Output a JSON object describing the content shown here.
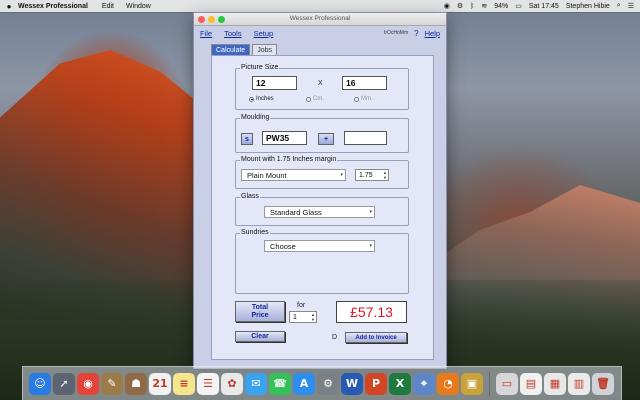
{
  "menubar": {
    "app_name": "Wessex Professional",
    "menus": [
      "Edit",
      "Window"
    ],
    "battery": "94%",
    "clock": "Sat 17:45",
    "user": "Stephen Hibie"
  },
  "window": {
    "title": "Wessex Professional",
    "menu": {
      "file": "File",
      "tools": "Tools",
      "setup": "Setup",
      "help": "Help"
    },
    "lang_label": "IrOcHoMm",
    "tabs": [
      {
        "label": "Calculate",
        "active": true
      },
      {
        "label": "Jobs",
        "active": false
      }
    ]
  },
  "picture_size": {
    "title": "Picture Size",
    "width": "12",
    "height": "16",
    "separator": "X",
    "units": [
      {
        "label": "Inches",
        "selected": true
      },
      {
        "label": "Cm.",
        "selected": false
      },
      {
        "label": "Mm.",
        "selected": false
      }
    ]
  },
  "moulding": {
    "title": "Moulding",
    "search_label": "s",
    "code": "PW35",
    "add_label": "+",
    "second_code": ""
  },
  "mount": {
    "title": "Mount with 1.75 Inches margin",
    "type": "Plain Mount",
    "margin": "1.75"
  },
  "glass": {
    "title": "Glass",
    "type": "Standard Glass"
  },
  "sundries": {
    "title": "Sundries",
    "choice": "Choose"
  },
  "pricing": {
    "total_label_line1": "Total",
    "total_label_line2": "Price",
    "for_label": "for",
    "quantity": "1",
    "price": "£57.13",
    "clear_label": "Clear",
    "invoice_marker": "D",
    "add_invoice_label": "Add to Invoice"
  },
  "dock": {
    "items": [
      {
        "name": "finder",
        "glyph": "☺",
        "color": "#2a7be4"
      },
      {
        "name": "launchpad",
        "glyph": "➚",
        "color": "#5b6470"
      },
      {
        "name": "chrome",
        "glyph": "◉",
        "color": "#e3443a"
      },
      {
        "name": "notefile",
        "glyph": "✎",
        "color": "#9c7a4a"
      },
      {
        "name": "contacts",
        "glyph": "☗",
        "color": "#8e6b46"
      },
      {
        "name": "calendar",
        "glyph": "21",
        "color": "#f1f1f1"
      },
      {
        "name": "notes",
        "glyph": "≡",
        "color": "#f5e58c"
      },
      {
        "name": "reminders",
        "glyph": "☰",
        "color": "#f4f4f4"
      },
      {
        "name": "photos",
        "glyph": "✿",
        "color": "#e8e8e8"
      },
      {
        "name": "messages",
        "glyph": "✉",
        "color": "#3aa3f0"
      },
      {
        "name": "facetime",
        "glyph": "☎",
        "color": "#35c15a"
      },
      {
        "name": "app-store",
        "glyph": "A",
        "color": "#2e8ef0"
      },
      {
        "name": "system-preferences",
        "glyph": "⚙",
        "color": "#7b7f86"
      },
      {
        "name": "word",
        "glyph": "W",
        "color": "#2a5bb4"
      },
      {
        "name": "powerpoint",
        "glyph": "P",
        "color": "#d24625"
      },
      {
        "name": "excel",
        "glyph": "X",
        "color": "#1f7a3d"
      },
      {
        "name": "preview",
        "glyph": "⌖",
        "color": "#5d86c9"
      },
      {
        "name": "firefox",
        "glyph": "◔",
        "color": "#e87a1e"
      },
      {
        "name": "wessex-app",
        "glyph": "▣",
        "color": "#c8a23a"
      }
    ],
    "right_items": [
      {
        "name": "drive",
        "glyph": "▭",
        "color": "#d7d7d7"
      },
      {
        "name": "documents",
        "glyph": "▤",
        "color": "#f0f0f0"
      },
      {
        "name": "screenshot",
        "glyph": "▦",
        "color": "#e8e8e8"
      },
      {
        "name": "downloads",
        "glyph": "▥",
        "color": "#eaeaea"
      },
      {
        "name": "trash",
        "glyph": "🗑",
        "color": "#cfd3d8"
      }
    ]
  }
}
